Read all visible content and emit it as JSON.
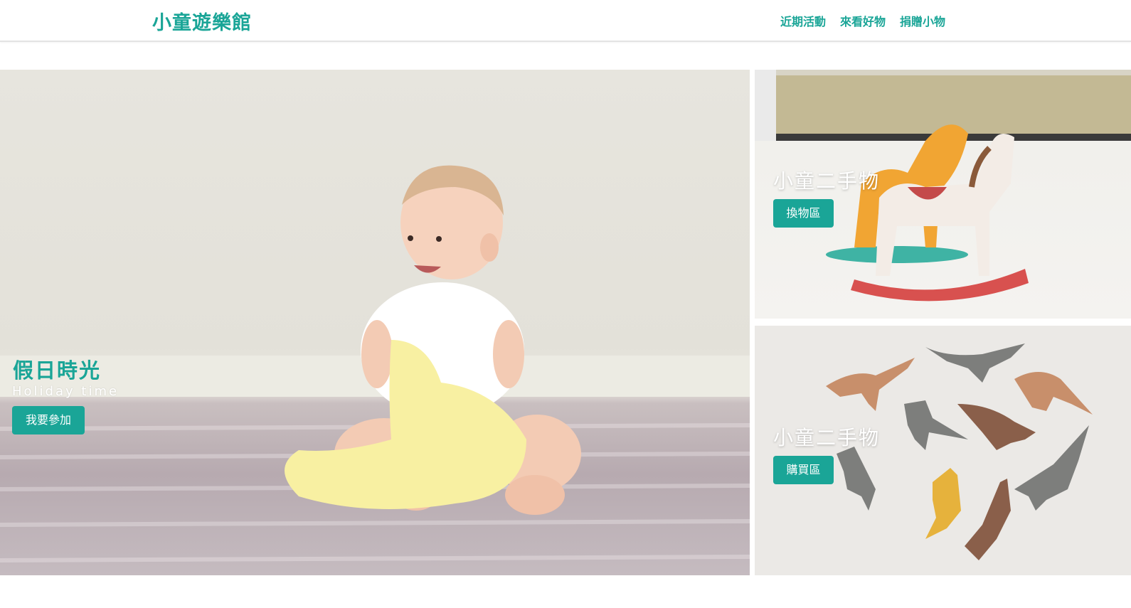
{
  "header": {
    "brand": "小童遊樂館",
    "nav": [
      "近期活動",
      "來看好物",
      "捐贈小物"
    ]
  },
  "hero": {
    "title": "假日時光",
    "subtitle": "Holiday time",
    "button": "我要參加",
    "image_icon": "baby-photo"
  },
  "cards": [
    {
      "title": "小童二手物",
      "button": "換物區",
      "image_icon": "rocking-horse-photo"
    },
    {
      "title": "小童二手物",
      "button": "購買區",
      "image_icon": "dinosaur-toys-photo"
    }
  ],
  "colors": {
    "accent": "#1aa597",
    "white": "#ffffff"
  }
}
